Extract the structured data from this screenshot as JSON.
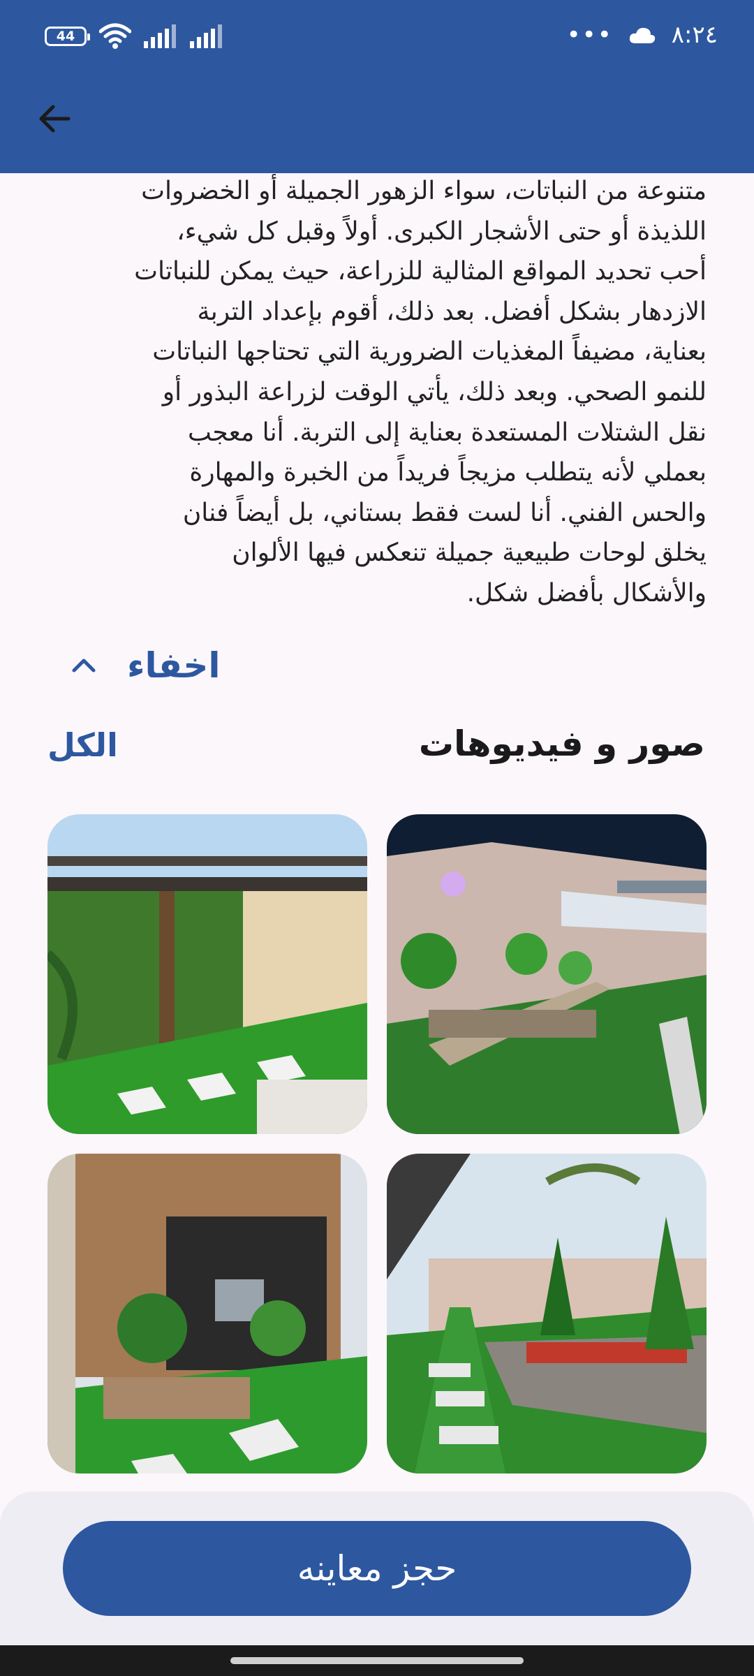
{
  "status": {
    "battery": "44",
    "time": "٨:٢٤",
    "overflow": "•••"
  },
  "description": {
    "lines": [
      "متنوعة من النباتات، سواء الزهور الجميلة أو الخضروات",
      "اللذيذة أو حتى الأشجار الكبرى.  أولاً وقبل كل شيء،",
      "أحب تحديد المواقع المثالية للزراعة، حيث يمكن للنباتات",
      "الازدهار بشكل أفضل. بعد ذلك، أقوم بإعداد التربة",
      "بعناية، مضيفاً المغذيات الضرورية التي تحتاجها النباتات",
      "للنمو الصحي. وبعد ذلك، يأتي الوقت لزراعة البذور أو",
      "نقل الشتلات المستعدة بعناية إلى التربة.  أنا معجب",
      "بعملي لأنه يتطلب مزيجاً فريداً من الخبرة والمهارة",
      "والحس الفني. أنا لست فقط بستاني، بل أيضاً فنان",
      "يخلق لوحات طبيعية جميلة تنعكس فيها الألوان",
      "والأشكال بأفضل شكل."
    ]
  },
  "toggle": {
    "label": "اخفاء",
    "icon": "chevron-up-icon"
  },
  "gallery": {
    "title": "صور و فيديوهات",
    "see_all": "الكل",
    "images": [
      "night-garden-photo",
      "pergola-garden-photo",
      "planter-path-garden-photo",
      "water-feature-garden-photo"
    ]
  },
  "cta": {
    "label": "حجز معاينه"
  },
  "colors": {
    "primary": "#2d58a0",
    "background": "#fcf7fb"
  }
}
